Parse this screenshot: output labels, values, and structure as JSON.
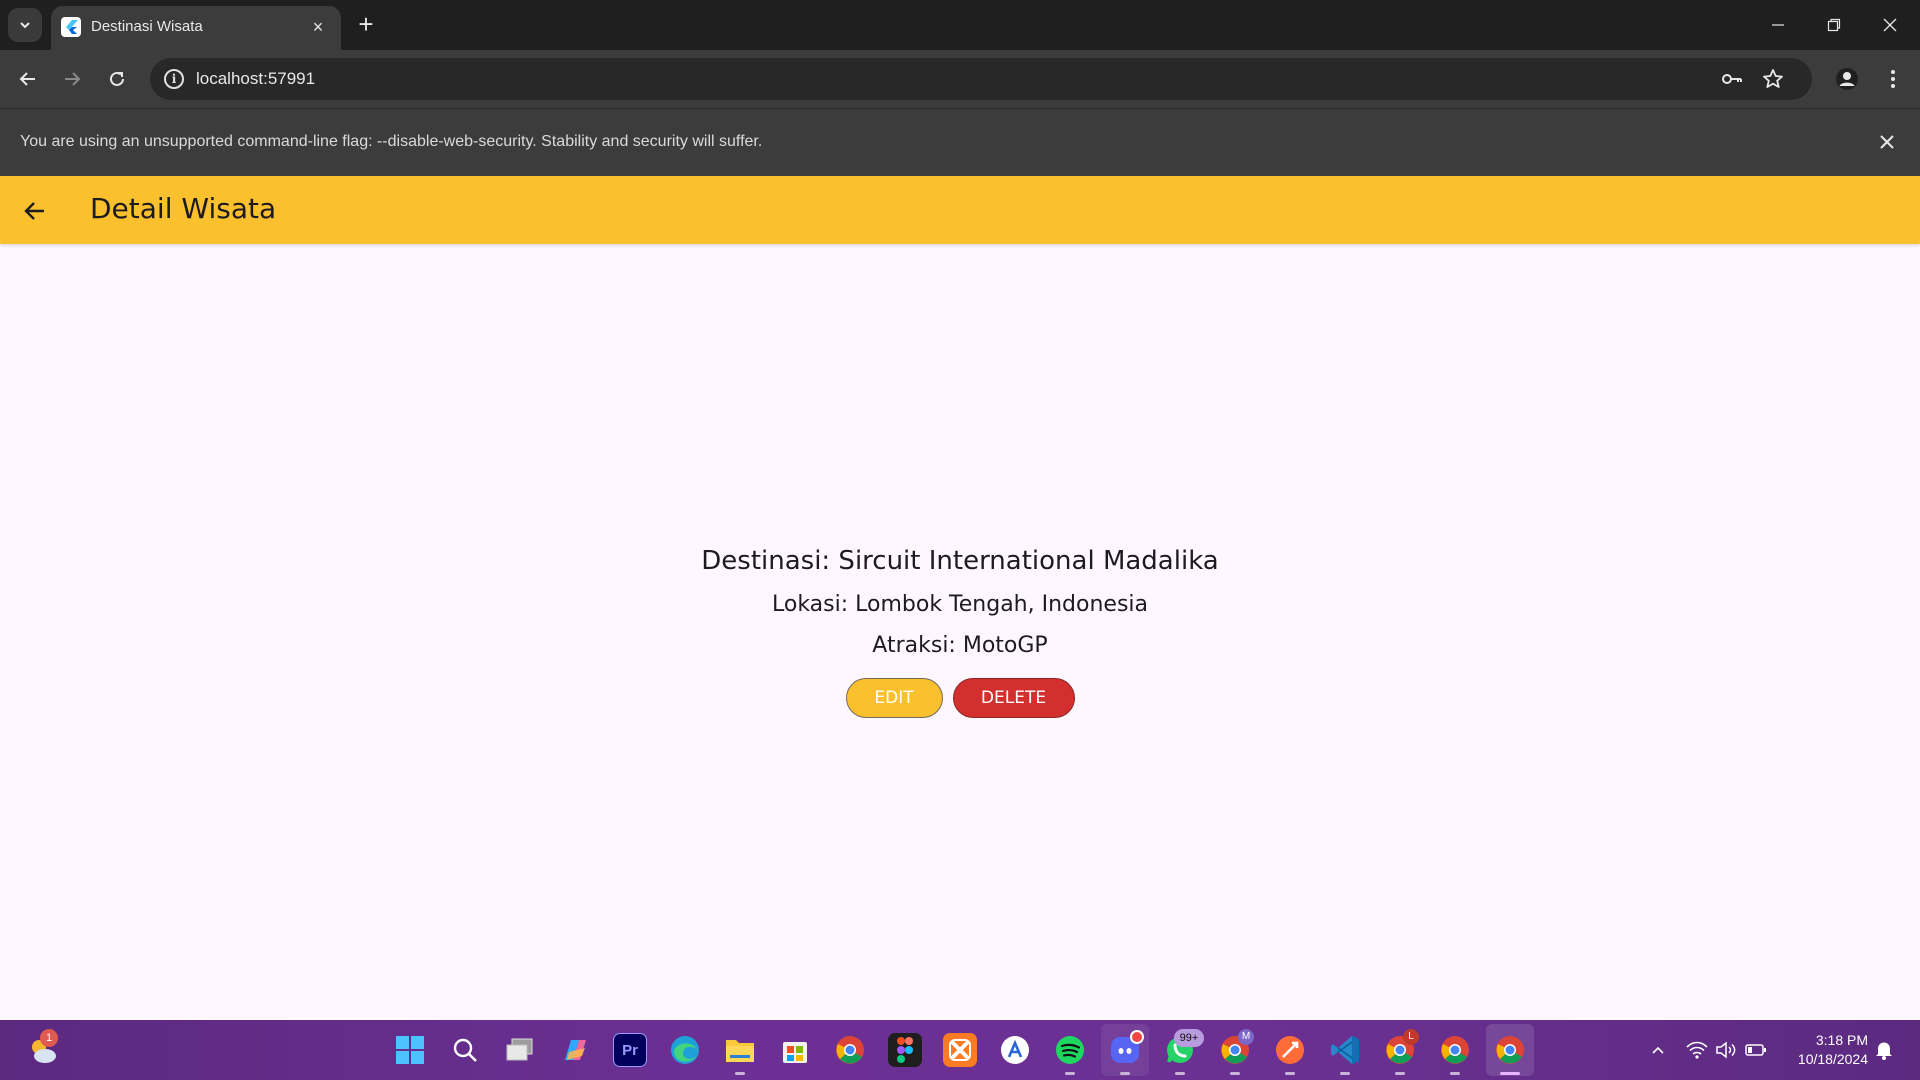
{
  "browser": {
    "tab_title": "Destinasi Wisata",
    "new_tab_symbol": "+",
    "tab_close_symbol": "×",
    "url": "localhost:57991",
    "infobar_text": "You are using an unsupported command-line flag: --disable-web-security. Stability and security will suffer."
  },
  "app": {
    "title": "Detail Wisata",
    "accent_color": "#fbc02d",
    "danger_color": "#d32f2f",
    "destination": "Destinasi: Sircuit International Madalika",
    "location": "Lokasi: Lombok Tengah, Indonesia",
    "attraction": "Atraksi: MotoGP",
    "edit_label": "EDIT",
    "delete_label": "DELETE"
  },
  "taskbar": {
    "weather_badge": "1",
    "whatsapp_badge": "99+",
    "chrome_profile_m": "M",
    "chrome_profile_l": "L",
    "premiere_label": "Pr",
    "time": "3:18 PM",
    "date": "10/18/2024"
  }
}
